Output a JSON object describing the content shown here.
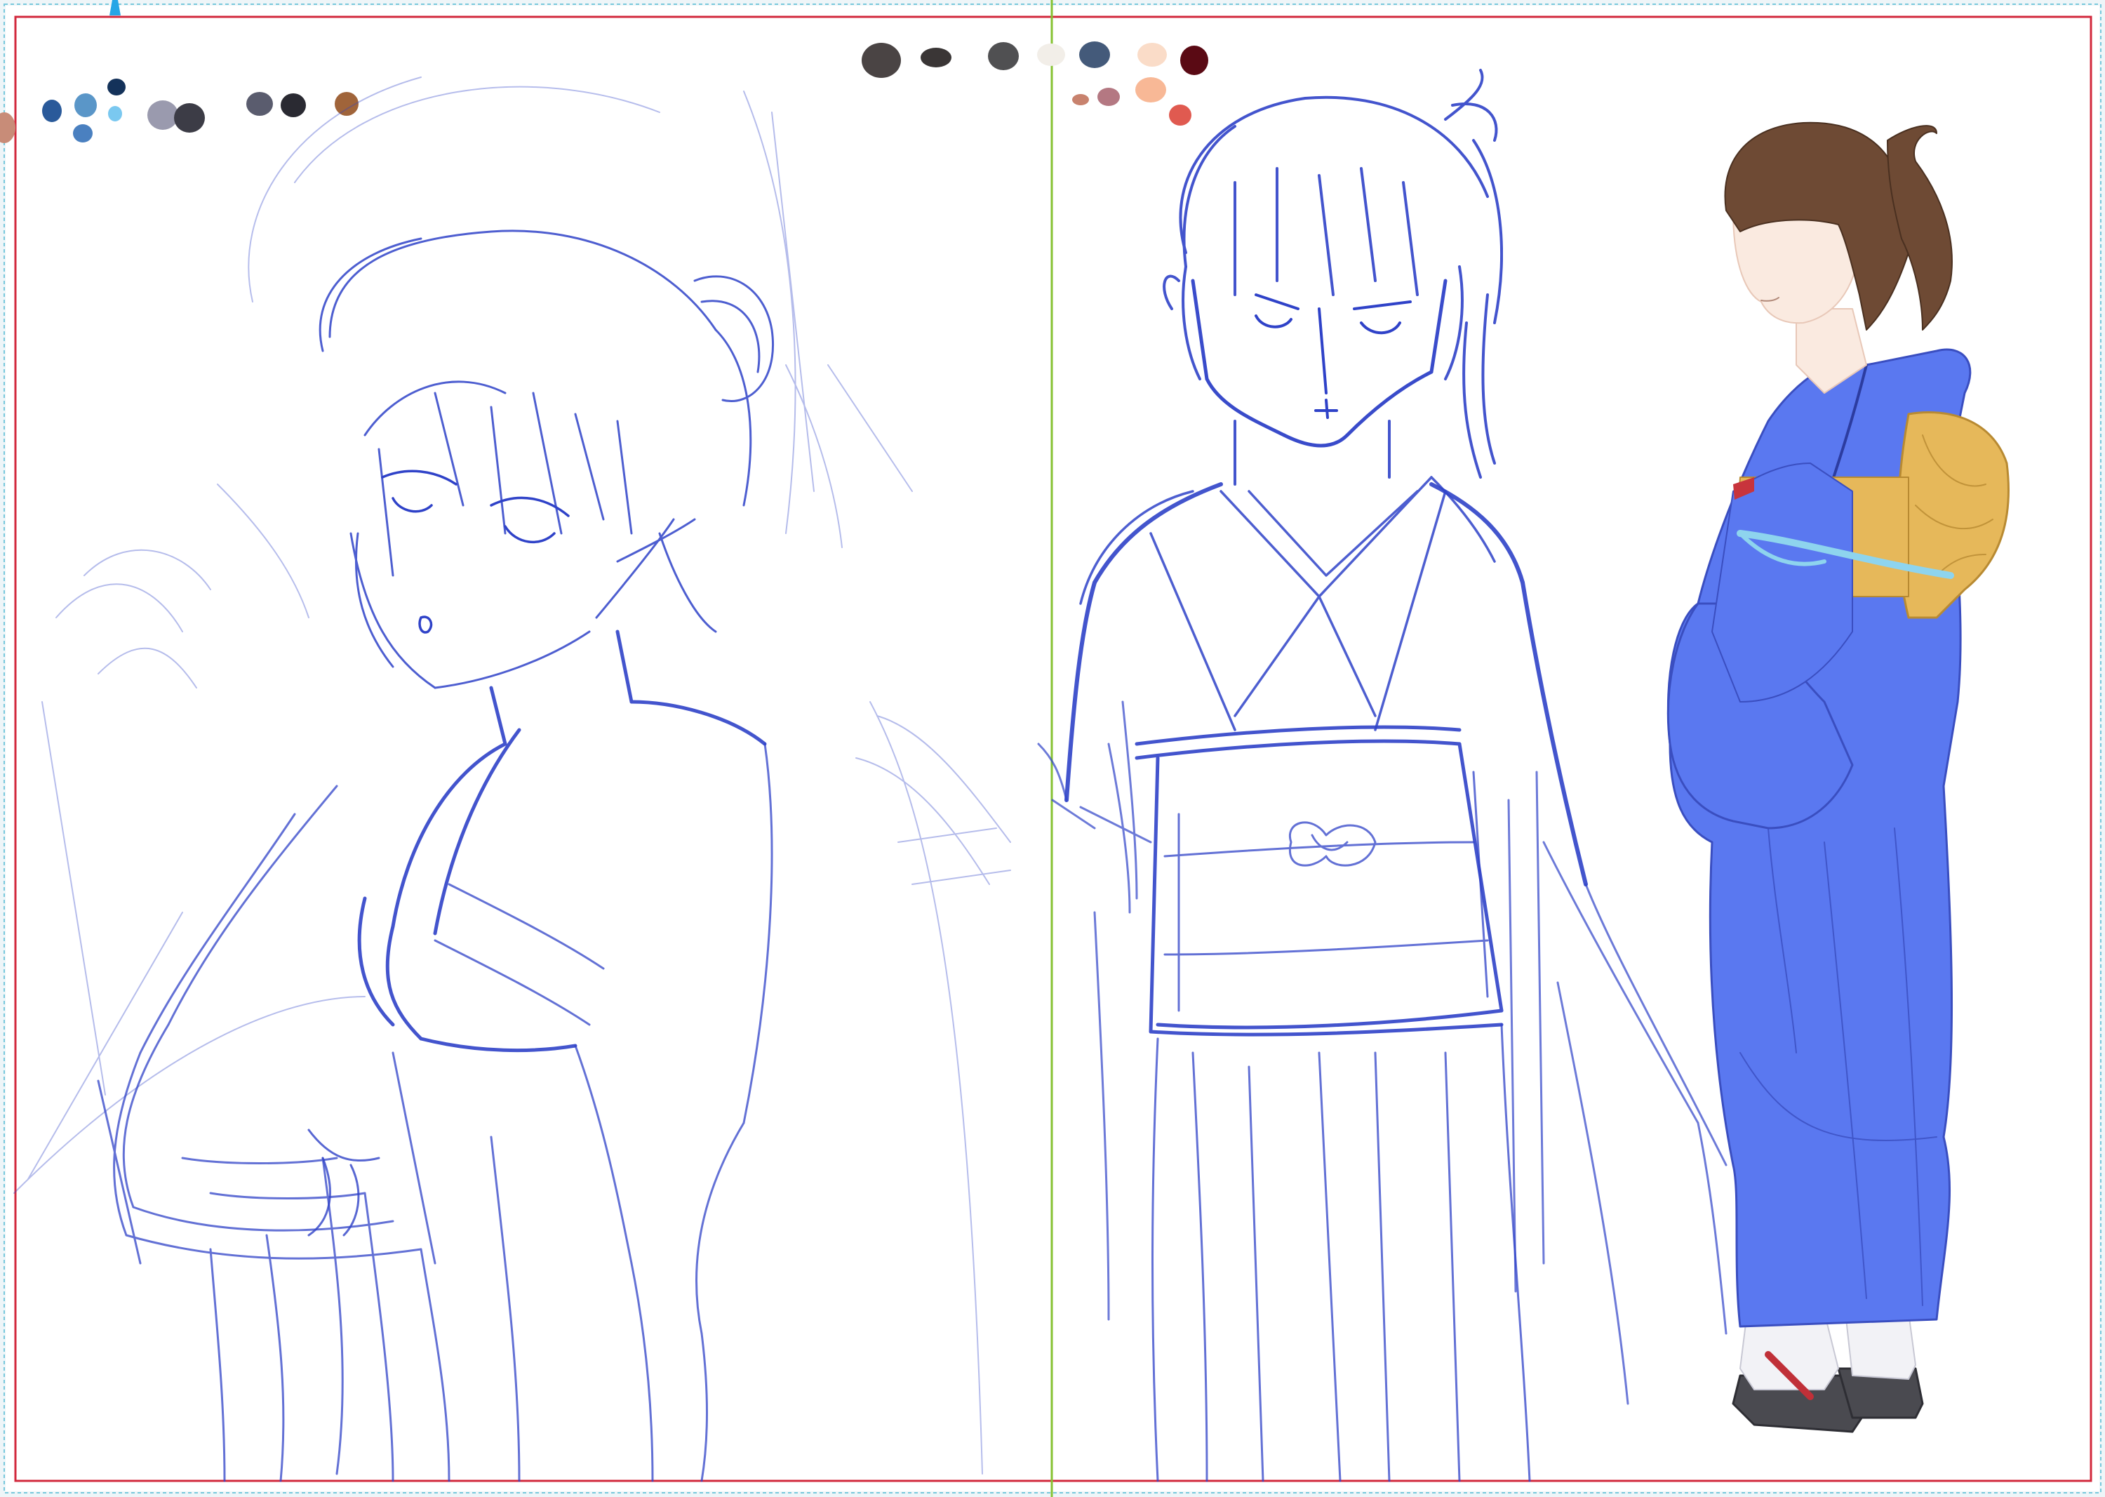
{
  "canvas": {
    "background": "#ffffff",
    "outer_border_color": "#78c8dc",
    "frame_color": "#d2283c",
    "guide_color": "#86c232",
    "ruler_marker_color": "#26a6e6"
  },
  "sketch_stroke_color": "#2f42c8",
  "palette_swatches": [
    {
      "color": "#c88c78",
      "group": "edge"
    },
    {
      "color": "#2a5a9a",
      "group": "left"
    },
    {
      "color": "#5a96c8",
      "group": "left"
    },
    {
      "color": "#14325a",
      "group": "left"
    },
    {
      "color": "#4a80c0",
      "group": "left"
    },
    {
      "color": "#7ac8f0",
      "group": "left"
    },
    {
      "color": "#9a9aae",
      "group": "left"
    },
    {
      "color": "#3c3c46",
      "group": "left"
    },
    {
      "color": "#5a5c6e",
      "group": "left"
    },
    {
      "color": "#2a2a32",
      "group": "left"
    },
    {
      "color": "#a0643a",
      "group": "left"
    },
    {
      "color": "#4a4444",
      "group": "top"
    },
    {
      "color": "#3a3636",
      "group": "top"
    },
    {
      "color": "#505052",
      "group": "top"
    },
    {
      "color": "#f2eee8",
      "group": "top"
    },
    {
      "color": "#445a7a",
      "group": "top"
    },
    {
      "color": "#fadcc8",
      "group": "top"
    },
    {
      "color": "#5a0a14",
      "group": "top"
    },
    {
      "color": "#c8826e",
      "group": "top"
    },
    {
      "color": "#b47882",
      "group": "top"
    },
    {
      "color": "#f8b896",
      "group": "top"
    },
    {
      "color": "#e05a50",
      "group": "top"
    }
  ],
  "figures": [
    {
      "name": "sketch-kimono-girl-three-quarter",
      "kind": "rough pencil sketch"
    },
    {
      "name": "sketch-kimono-girl-front",
      "kind": "rough pencil sketch"
    },
    {
      "name": "colored-kimono-girl-side",
      "kind": "flat color figure",
      "colors": {
        "kimono": "#5a78f0",
        "obi": "#e6b85a",
        "hair": "#6e4a34",
        "skin": "#faeae0",
        "obijime": "#8ed4ee",
        "zori": "#4a4a50",
        "tabi": "#f2f2f6",
        "hanao": "#c03038"
      }
    }
  ]
}
